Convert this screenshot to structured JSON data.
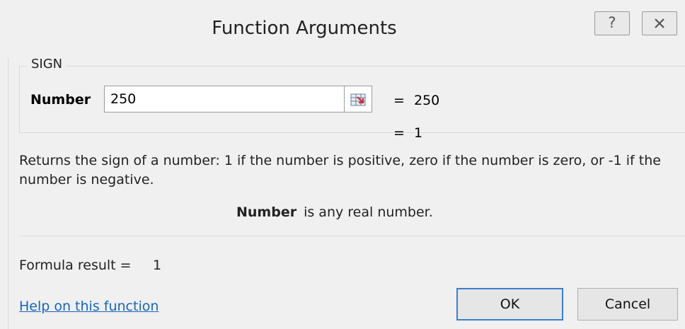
{
  "dialog": {
    "title": "Function Arguments",
    "help_label": "?",
    "close_icon": "close-icon"
  },
  "function": {
    "name": "SIGN",
    "arguments": [
      {
        "label": "Number",
        "value": "250",
        "evaluated": "250"
      }
    ],
    "result_equals": "=",
    "result": "1",
    "description": "Returns the sign of a number: 1 if the number is positive, zero if the number is zero, or -1 if the number is negative.",
    "param_name": "Number",
    "param_description": "is any real number."
  },
  "footer": {
    "formula_result_label": "Formula result =",
    "formula_result": "1",
    "help_link": "Help on this function",
    "ok_label": "OK",
    "cancel_label": "Cancel"
  },
  "colors": {
    "link": "#1565c0",
    "ok_border": "#3c7fd0"
  }
}
